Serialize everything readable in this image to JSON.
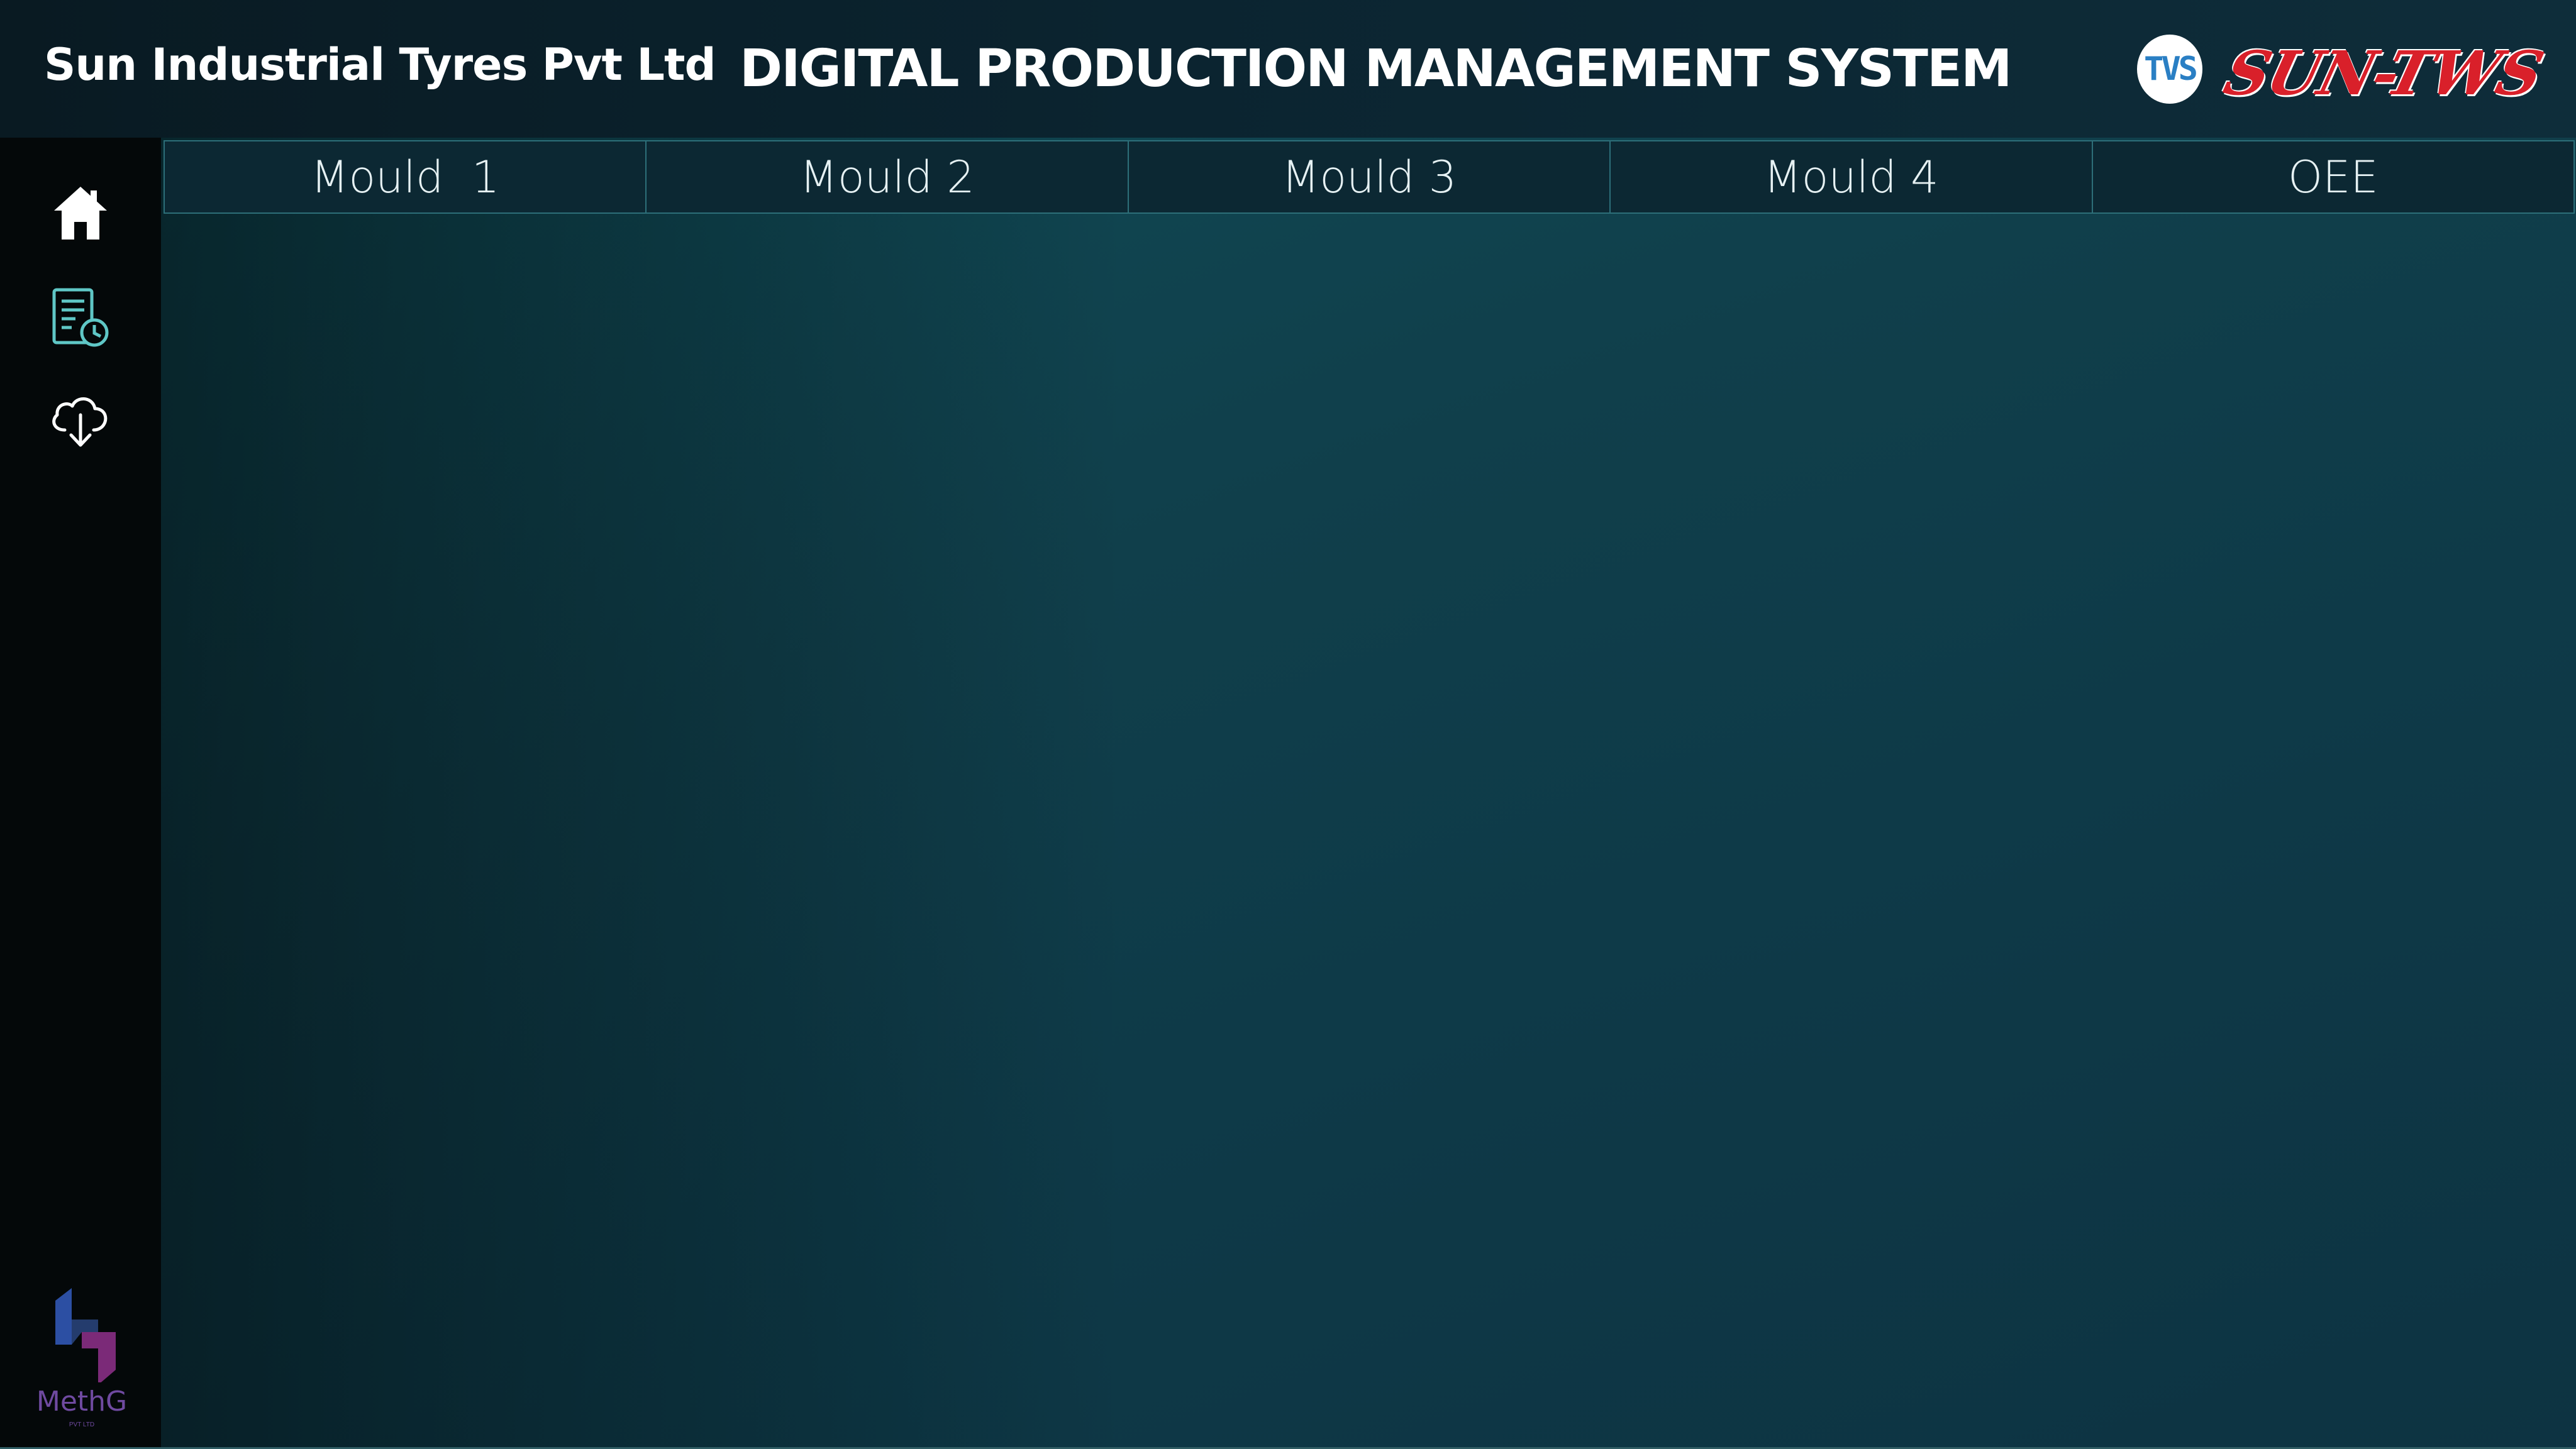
{
  "header": {
    "company_name": "Sun Industrial Tyres Pvt Ltd",
    "system_title": "DIGITAL PRODUCTION MANAGEMENT SYSTEM",
    "logo_left": "TVS",
    "logo_right": "SUN-TWS"
  },
  "sidebar": {
    "items": [
      {
        "icon": "home-icon"
      },
      {
        "icon": "report-clock-icon"
      },
      {
        "icon": "cloud-download-icon"
      }
    ],
    "footer_logo": "MethG",
    "footer_logo_sub": "PVT LTD"
  },
  "tabs": [
    {
      "label": "Mould  1"
    },
    {
      "label": "Mould 2"
    },
    {
      "label": "Mould 3"
    },
    {
      "label": "Mould 4"
    },
    {
      "label": "OEE"
    }
  ],
  "colors": {
    "header_bg": "#0b2430",
    "sidebar_bg": "#040809",
    "main_bg": "#0f4a55",
    "tab_border": "#2d6f79",
    "brand_red": "#d9202a",
    "icon_teal": "#5fc7c6"
  }
}
